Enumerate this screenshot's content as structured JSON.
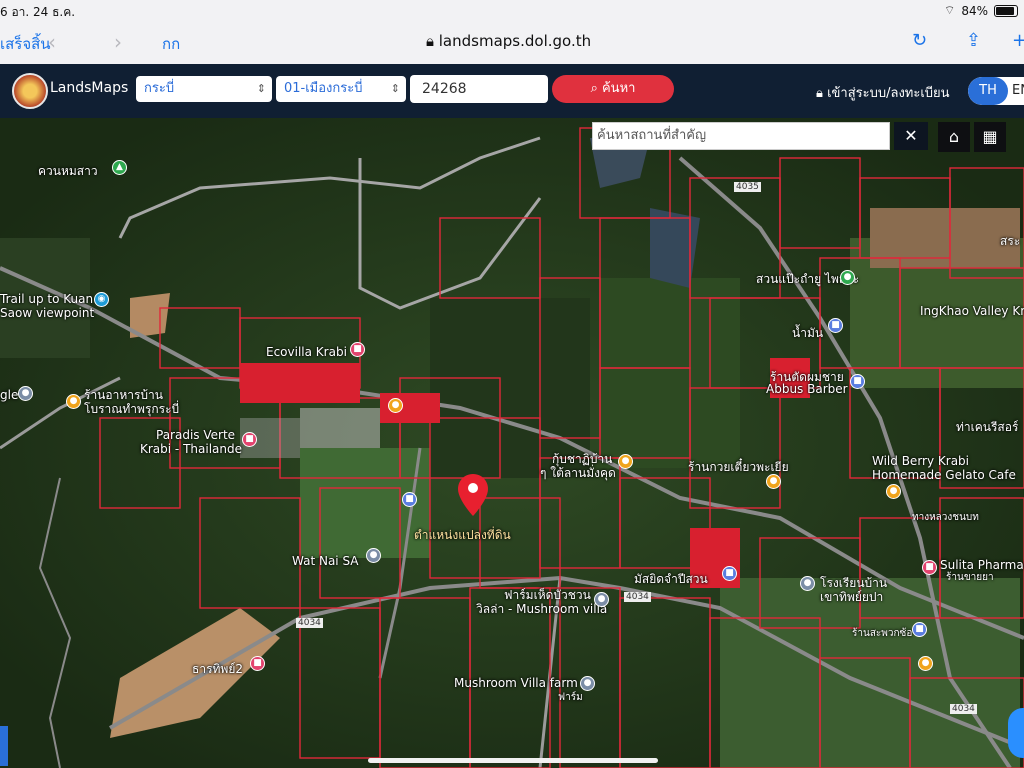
{
  "status": {
    "time": "6  อา. 24 ธ.ค.",
    "battery": "84%",
    "wifi_icon": "wifi-icon"
  },
  "browser": {
    "done_label": "เสร็จสิ้น",
    "aa_label": "กก",
    "address": "landsmaps.dol.go.th"
  },
  "app": {
    "name": "LandsMaps",
    "province": "กระบี่",
    "district": "01-เมืองกระบี่",
    "parcel_number": "24268",
    "search_label": "ค้นหา",
    "login_label": "เข้าสู่ระบบ/ลงทะเบียน",
    "lang_th": "TH",
    "lang_en": "EN"
  },
  "map": {
    "place_search_placeholder": "ค้นหาสถานที่สำคัญ",
    "labels": {
      "l1": "ควนหมสาว",
      "l2": "Trail up to Kuan",
      "l3": "Saow viewpoint",
      "l4": "Ecovilla Krabi",
      "l5": "ร้านอาหารบ้าน",
      "l6": "โบราณทำพรุกระบี่",
      "l7": "Paradis Verte",
      "l8": "Krabi - Thailande",
      "l9": "gle",
      "l10": "Wat Nai SA",
      "l11": "ตำแหน่งแปลงที่ดิน",
      "l12": "กุ้บชาฏิบ้าน",
      "l13": "ๆ ใต้ลานมั่งคุด",
      "l14": "ร้านกวยเตี๋ยวพะเยีย",
      "l15": "สวนแป๊ะถำยู ไพสระ",
      "l16": "ร้านตัดผมชาย",
      "l17": "Abbus Barber",
      "l18": "IngKhao Valley Kr",
      "l19": "ท่าเคนรีสอร์",
      "l20": "Wild Berry Krabi",
      "l21": "Homemade Gelato Cafe",
      "l22": "มัสยิดจำปีสวน",
      "l23": "ฟาร์มเห็ดบัวชวน",
      "l24": "วิลล่า - Mushroom villa",
      "l25": "โรงเรียนบ้าน",
      "l26": "เขาทิพย์ยปา",
      "l27": "Sulita Pharmac",
      "l28": "ร้านขายยา",
      "l29": "ร้านสะพวกซ้อ",
      "l30": "Mushroom Villa farm",
      "l31": "ฟาร์ม",
      "l32": "ธารทิพย์2",
      "l33": "สระ",
      "l34": "ทางหลวงชนบท",
      "l35": "น้ำมัน",
      "l36": "4034",
      "l37": "4034",
      "l38": "4034",
      "l39": "4035"
    }
  }
}
